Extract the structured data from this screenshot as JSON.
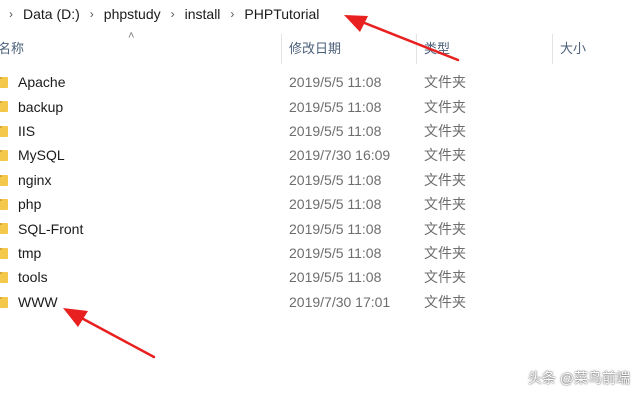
{
  "breadcrumb": {
    "items": [
      "Data (D:)",
      "phpstudy",
      "install",
      "PHPTutorial"
    ]
  },
  "columns": {
    "name": "名称",
    "date": "修改日期",
    "type": "类型",
    "size": "大小"
  },
  "files": [
    {
      "name": "Apache",
      "date": "2019/5/5 11:08",
      "type": "文件夹"
    },
    {
      "name": "backup",
      "date": "2019/5/5 11:08",
      "type": "文件夹"
    },
    {
      "name": "IIS",
      "date": "2019/5/5 11:08",
      "type": "文件夹"
    },
    {
      "name": "MySQL",
      "date": "2019/7/30 16:09",
      "type": "文件夹"
    },
    {
      "name": "nginx",
      "date": "2019/5/5 11:08",
      "type": "文件夹"
    },
    {
      "name": "php",
      "date": "2019/5/5 11:08",
      "type": "文件夹"
    },
    {
      "name": "SQL-Front",
      "date": "2019/5/5 11:08",
      "type": "文件夹"
    },
    {
      "name": "tmp",
      "date": "2019/5/5 11:08",
      "type": "文件夹"
    },
    {
      "name": "tools",
      "date": "2019/5/5 11:08",
      "type": "文件夹"
    },
    {
      "name": "WWW",
      "date": "2019/7/30 17:01",
      "type": "文件夹"
    }
  ],
  "icons": {
    "folder": "folder-icon",
    "separator": "chevron-right-icon",
    "sort": "sort-up-icon"
  },
  "colors": {
    "folder": "#f3c84b",
    "folder_dark": "#d9a53a",
    "header_text": "#4c607a",
    "annotation": "#e8201f"
  },
  "watermark": "头条 @菜鸟前端"
}
